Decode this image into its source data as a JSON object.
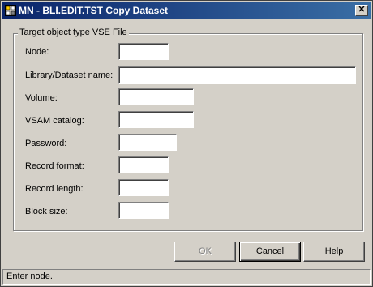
{
  "window": {
    "title": "MN - BLI.EDIT.TST Copy Dataset",
    "close_label": "✕"
  },
  "group": {
    "legend": "Target object type VSE File"
  },
  "fields": {
    "node": {
      "label": "Node:",
      "value": ""
    },
    "library_dataset": {
      "label": "Library/Dataset name:",
      "value": ""
    },
    "volume": {
      "label": "Volume:",
      "value": ""
    },
    "vsam_catalog": {
      "label": "VSAM catalog:",
      "value": ""
    },
    "password": {
      "label": "Password:",
      "value": ""
    },
    "record_format": {
      "label": "Record format:",
      "value": ""
    },
    "record_length": {
      "label": "Record length:",
      "value": ""
    },
    "block_size": {
      "label": "Block size:",
      "value": ""
    }
  },
  "buttons": {
    "ok": "OK",
    "cancel": "Cancel",
    "help": "Help"
  },
  "status": {
    "text": "Enter node."
  }
}
